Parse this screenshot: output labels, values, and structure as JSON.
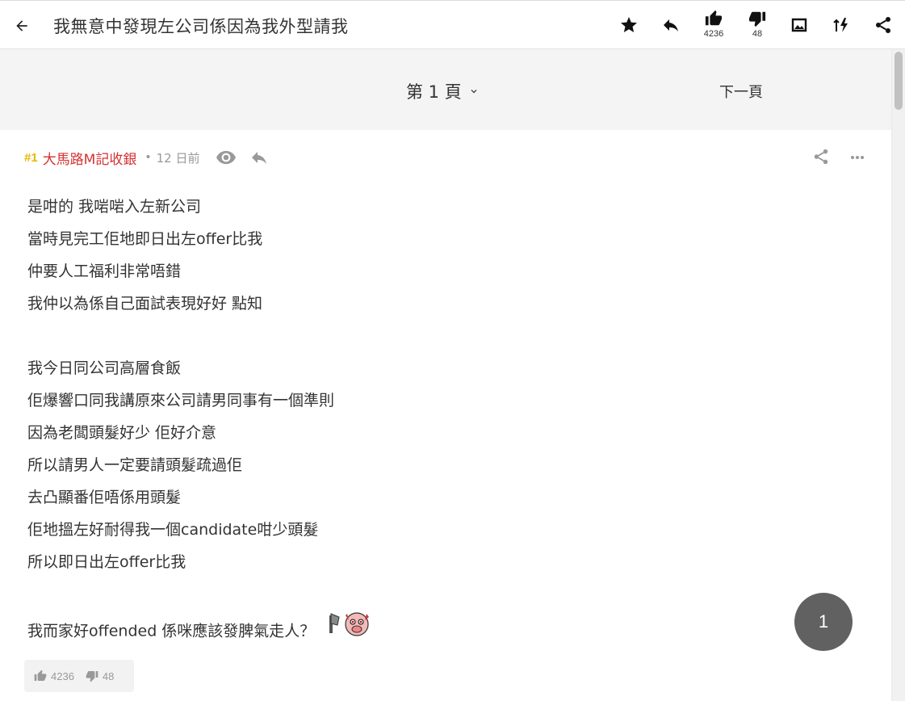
{
  "topbar": {
    "title": "我無意中發現左公司係因為我外型請我",
    "like_count": "4236",
    "dislike_count": "48"
  },
  "pager": {
    "current_page": "第 1 頁",
    "next_label": "下一頁"
  },
  "post": {
    "floor": "#1",
    "author": "大馬路M記收銀",
    "separator": "•",
    "time": "12 日前",
    "lines": [
      "是咁的 我啱啱入左新公司",
      "當時見完工佢地即日出左offer比我",
      "仲要人工福利非常唔錯",
      "我仲以為係自己面試表現好好 點知",
      "",
      "我今日同公司高層食飯",
      "佢爆響口同我講原來公司請男同事有一個準則",
      "因為老闆頭髮好少 佢好介意",
      "所以請男人一定要請頭髮疏過佢",
      "去凸顯番佢唔係用頭髮",
      "佢地搵左好耐得我一個candidate咁少頭髮",
      "所以即日出左offer比我",
      "",
      "我而家好offended 係咪應該發脾氣走人？"
    ],
    "like_count": "4236",
    "dislike_count": "48"
  },
  "page_fab": "1",
  "icons": {
    "back": "arrow-left-icon",
    "star": "star-icon",
    "reply": "reply-icon",
    "like": "thumb-up-icon",
    "dislike": "thumb-down-icon",
    "image": "image-mode-icon",
    "sort": "sort-icon",
    "share": "share-icon",
    "eye": "eye-icon",
    "more": "more-horizontal-icon",
    "chevron": "chevron-down-icon"
  },
  "colors": {
    "floor": "#e6b800",
    "author": "#d53232",
    "fab": "#616161"
  }
}
